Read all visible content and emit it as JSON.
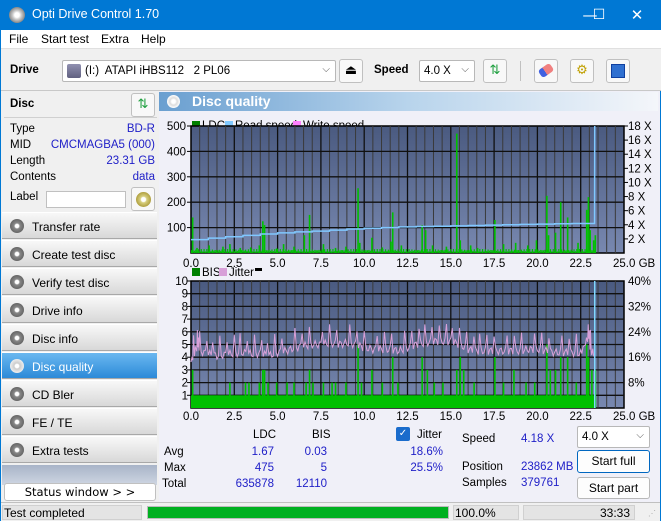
{
  "window": {
    "title": "Opti Drive Control 1.70",
    "minimize": "—",
    "maximize": "☐",
    "close": "✕"
  },
  "menu": [
    "File",
    "Start test",
    "Extra",
    "Help"
  ],
  "toolbar": {
    "drive_label": "Drive",
    "drive_value": "(I:)  ATAPI iHBS112   2 PL06",
    "speed_label": "Speed",
    "speed_value": "4.0 X",
    "icons": [
      "eject-icon",
      "refresh-icon",
      "erase-icon",
      "settings-icon",
      "save-icon"
    ]
  },
  "disc": {
    "header": "Disc",
    "rows": [
      {
        "key": "Type",
        "value": "BD-R"
      },
      {
        "key": "MID",
        "value": "CMCMAGBA5 (000)"
      },
      {
        "key": "Length",
        "value": "23.31 GB"
      },
      {
        "key": "Contents",
        "value": "data"
      }
    ],
    "label_key": "Label",
    "label_value": ""
  },
  "nav": [
    {
      "label": "Transfer rate",
      "active": false
    },
    {
      "label": "Create test disc",
      "active": false
    },
    {
      "label": "Verify test disc",
      "active": false
    },
    {
      "label": "Drive info",
      "active": false
    },
    {
      "label": "Disc info",
      "active": false
    },
    {
      "label": "Disc quality",
      "active": true
    },
    {
      "label": "CD Bler",
      "active": false
    },
    {
      "label": "FE / TE",
      "active": false
    },
    {
      "label": "Extra tests",
      "active": false
    }
  ],
  "status_window_button": "Status window > >",
  "panel_title": "Disc quality",
  "colors": {
    "ldc": "#00c000",
    "read_speed": "#80c8ff",
    "write_speed": "#ff80ff",
    "bis": "#00c000",
    "jitter": "#d8a0d8",
    "plot_bg_top": "#4a5a80",
    "plot_bg_bottom": "#7888b0",
    "progress": "#00b020"
  },
  "chart_data": [
    {
      "type": "bar",
      "title": "LDC / Read speed",
      "legend": [
        "LDC",
        "Read speed",
        "Write speed"
      ],
      "legend_position": "top-left",
      "xlabel": "GB",
      "x_ticks": [
        "0.0",
        "2.5",
        "5.0",
        "7.5",
        "10.0",
        "12.5",
        "15.0",
        "17.5",
        "20.0",
        "22.5",
        "25.0 GB"
      ],
      "xlim": [
        0,
        25
      ],
      "y_ticks": [
        "100",
        "200",
        "300",
        "400",
        "500"
      ],
      "ylim": [
        0,
        500
      ],
      "y2_ticks": [
        "2 X",
        "4 X",
        "6 X",
        "8 X",
        "10 X",
        "12 X",
        "14 X",
        "16 X",
        "18 X"
      ],
      "y2lim": [
        0,
        18
      ],
      "grid": true,
      "ldc_spikes": [
        {
          "x": 0.05,
          "y": 140
        },
        {
          "x": 0.3,
          "y": 20
        },
        {
          "x": 1.0,
          "y": 30
        },
        {
          "x": 1.8,
          "y": 25
        },
        {
          "x": 2.2,
          "y": 35
        },
        {
          "x": 2.8,
          "y": 20
        },
        {
          "x": 3.4,
          "y": 22
        },
        {
          "x": 3.9,
          "y": 30
        },
        {
          "x": 4.1,
          "y": 125
        },
        {
          "x": 4.2,
          "y": 110
        },
        {
          "x": 4.9,
          "y": 18
        },
        {
          "x": 5.3,
          "y": 35
        },
        {
          "x": 5.9,
          "y": 25
        },
        {
          "x": 6.5,
          "y": 70
        },
        {
          "x": 6.8,
          "y": 150
        },
        {
          "x": 7.6,
          "y": 35
        },
        {
          "x": 8.3,
          "y": 20
        },
        {
          "x": 8.9,
          "y": 25
        },
        {
          "x": 9.6,
          "y": 255
        },
        {
          "x": 9.7,
          "y": 40
        },
        {
          "x": 10.4,
          "y": 60
        },
        {
          "x": 11.0,
          "y": 22
        },
        {
          "x": 11.5,
          "y": 45
        },
        {
          "x": 11.6,
          "y": 160
        },
        {
          "x": 12.1,
          "y": 30
        },
        {
          "x": 13.3,
          "y": 110
        },
        {
          "x": 13.5,
          "y": 90
        },
        {
          "x": 13.9,
          "y": 30
        },
        {
          "x": 14.7,
          "y": 25
        },
        {
          "x": 15.3,
          "y": 470
        },
        {
          "x": 15.5,
          "y": 50
        },
        {
          "x": 16.1,
          "y": 30
        },
        {
          "x": 16.5,
          "y": 20
        },
        {
          "x": 17.5,
          "y": 130
        },
        {
          "x": 18.0,
          "y": 35
        },
        {
          "x": 18.7,
          "y": 40
        },
        {
          "x": 19.4,
          "y": 30
        },
        {
          "x": 19.9,
          "y": 50
        },
        {
          "x": 20.5,
          "y": 225
        },
        {
          "x": 20.6,
          "y": 70
        },
        {
          "x": 21.0,
          "y": 80
        },
        {
          "x": 21.3,
          "y": 200
        },
        {
          "x": 21.7,
          "y": 140
        },
        {
          "x": 22.3,
          "y": 40
        },
        {
          "x": 22.8,
          "y": 170
        },
        {
          "x": 22.9,
          "y": 220
        },
        {
          "x": 23.0,
          "y": 90
        },
        {
          "x": 23.2,
          "y": 50
        },
        {
          "x": 23.3,
          "y": 70
        }
      ],
      "read_speed": [
        {
          "x": 0.0,
          "y": 1.9
        },
        {
          "x": 1.0,
          "y": 2.1
        },
        {
          "x": 2.0,
          "y": 2.3
        },
        {
          "x": 3.0,
          "y": 2.5
        },
        {
          "x": 4.0,
          "y": 2.7
        },
        {
          "x": 5.0,
          "y": 2.85
        },
        {
          "x": 6.0,
          "y": 3.0
        },
        {
          "x": 7.0,
          "y": 3.1
        },
        {
          "x": 8.0,
          "y": 3.25
        },
        {
          "x": 9.0,
          "y": 3.4
        },
        {
          "x": 10.0,
          "y": 3.5
        },
        {
          "x": 11.0,
          "y": 3.6
        },
        {
          "x": 12.0,
          "y": 3.7
        },
        {
          "x": 13.0,
          "y": 3.75
        },
        {
          "x": 14.0,
          "y": 3.8
        },
        {
          "x": 15.0,
          "y": 3.85
        },
        {
          "x": 16.0,
          "y": 3.9
        },
        {
          "x": 17.0,
          "y": 3.95
        },
        {
          "x": 18.0,
          "y": 4.0
        },
        {
          "x": 19.0,
          "y": 4.05
        },
        {
          "x": 20.0,
          "y": 4.1
        },
        {
          "x": 21.0,
          "y": 4.15
        },
        {
          "x": 22.0,
          "y": 4.18
        },
        {
          "x": 23.3,
          "y": 4.2
        },
        {
          "x": 23.31,
          "y": 18
        }
      ]
    },
    {
      "type": "bar",
      "title": "BIS / Jitter",
      "legend": [
        "BIS",
        "Jitter"
      ],
      "legend_position": "top-left",
      "xlabel": "GB",
      "x_ticks": [
        "0.0",
        "2.5",
        "5.0",
        "7.5",
        "10.0",
        "12.5",
        "15.0",
        "17.5",
        "20.0",
        "22.5",
        "25.0 GB"
      ],
      "xlim": [
        0,
        25
      ],
      "y_ticks": [
        "1",
        "2",
        "3",
        "4",
        "5",
        "6",
        "7",
        "8",
        "9",
        "10"
      ],
      "ylim": [
        0,
        10
      ],
      "y2_ticks": [
        "8%",
        "16%",
        "24%",
        "32%",
        "40%"
      ],
      "y2lim": [
        0,
        40
      ],
      "grid": true,
      "bis_baseline": 1,
      "bis_spikes": [
        {
          "x": 0.05,
          "y": 3
        },
        {
          "x": 2.2,
          "y": 2
        },
        {
          "x": 3.1,
          "y": 2
        },
        {
          "x": 3.3,
          "y": 2
        },
        {
          "x": 3.9,
          "y": 2
        },
        {
          "x": 4.1,
          "y": 3
        },
        {
          "x": 4.2,
          "y": 3
        },
        {
          "x": 4.4,
          "y": 2
        },
        {
          "x": 4.9,
          "y": 2
        },
        {
          "x": 5.5,
          "y": 2
        },
        {
          "x": 5.9,
          "y": 2
        },
        {
          "x": 6.6,
          "y": 2
        },
        {
          "x": 6.8,
          "y": 3
        },
        {
          "x": 7.0,
          "y": 2
        },
        {
          "x": 7.6,
          "y": 2
        },
        {
          "x": 8.1,
          "y": 2
        },
        {
          "x": 8.3,
          "y": 2
        },
        {
          "x": 8.9,
          "y": 2
        },
        {
          "x": 9.6,
          "y": 5
        },
        {
          "x": 9.8,
          "y": 2
        },
        {
          "x": 10.4,
          "y": 3
        },
        {
          "x": 11.0,
          "y": 2
        },
        {
          "x": 11.6,
          "y": 4
        },
        {
          "x": 11.9,
          "y": 2
        },
        {
          "x": 13.3,
          "y": 4
        },
        {
          "x": 13.6,
          "y": 3
        },
        {
          "x": 14.0,
          "y": 2
        },
        {
          "x": 14.5,
          "y": 2
        },
        {
          "x": 15.3,
          "y": 3
        },
        {
          "x": 15.5,
          "y": 4
        },
        {
          "x": 15.7,
          "y": 3
        },
        {
          "x": 16.3,
          "y": 2
        },
        {
          "x": 17.5,
          "y": 4
        },
        {
          "x": 18.0,
          "y": 2
        },
        {
          "x": 18.6,
          "y": 3
        },
        {
          "x": 19.3,
          "y": 2
        },
        {
          "x": 19.8,
          "y": 2
        },
        {
          "x": 20.5,
          "y": 5
        },
        {
          "x": 20.7,
          "y": 3
        },
        {
          "x": 21.0,
          "y": 3
        },
        {
          "x": 21.3,
          "y": 4
        },
        {
          "x": 21.7,
          "y": 4
        },
        {
          "x": 22.2,
          "y": 2
        },
        {
          "x": 22.8,
          "y": 5
        },
        {
          "x": 22.9,
          "y": 4
        },
        {
          "x": 23.1,
          "y": 3
        },
        {
          "x": 23.3,
          "y": 3
        }
      ],
      "jitter": [
        {
          "x": 0.0,
          "y": 14.5
        },
        {
          "x": 0.3,
          "y": 19
        },
        {
          "x": 0.5,
          "y": 18
        },
        {
          "x": 1.0,
          "y": 17
        },
        {
          "x": 1.5,
          "y": 16.5
        },
        {
          "x": 2.0,
          "y": 16.8
        },
        {
          "x": 2.5,
          "y": 17.2
        },
        {
          "x": 3.0,
          "y": 17.5
        },
        {
          "x": 3.5,
          "y": 17
        },
        {
          "x": 4.0,
          "y": 17.2
        },
        {
          "x": 4.5,
          "y": 16.5
        },
        {
          "x": 5.0,
          "y": 17.5
        },
        {
          "x": 5.5,
          "y": 18
        },
        {
          "x": 6.0,
          "y": 19
        },
        {
          "x": 6.5,
          "y": 19.5
        },
        {
          "x": 7.0,
          "y": 20
        },
        {
          "x": 7.5,
          "y": 20
        },
        {
          "x": 8.0,
          "y": 20.5
        },
        {
          "x": 8.5,
          "y": 20
        },
        {
          "x": 9.0,
          "y": 20.5
        },
        {
          "x": 9.5,
          "y": 20
        },
        {
          "x": 10.0,
          "y": 19
        },
        {
          "x": 10.5,
          "y": 18.5
        },
        {
          "x": 11.0,
          "y": 18.5
        },
        {
          "x": 11.5,
          "y": 18.5
        },
        {
          "x": 12.0,
          "y": 18
        },
        {
          "x": 12.5,
          "y": 19
        },
        {
          "x": 13.0,
          "y": 20
        },
        {
          "x": 13.5,
          "y": 20.5
        },
        {
          "x": 14.0,
          "y": 21
        },
        {
          "x": 14.5,
          "y": 21
        },
        {
          "x": 15.0,
          "y": 21
        },
        {
          "x": 15.5,
          "y": 20
        },
        {
          "x": 16.0,
          "y": 18.5
        },
        {
          "x": 16.5,
          "y": 18
        },
        {
          "x": 17.0,
          "y": 18
        },
        {
          "x": 17.5,
          "y": 18
        },
        {
          "x": 18.0,
          "y": 18
        },
        {
          "x": 18.5,
          "y": 18
        },
        {
          "x": 19.0,
          "y": 18
        },
        {
          "x": 19.5,
          "y": 18.5
        },
        {
          "x": 20.0,
          "y": 18.5
        },
        {
          "x": 20.5,
          "y": 18
        },
        {
          "x": 21.0,
          "y": 17.5
        },
        {
          "x": 21.5,
          "y": 17.5
        },
        {
          "x": 22.0,
          "y": 17.5
        },
        {
          "x": 22.5,
          "y": 17.2
        },
        {
          "x": 22.9,
          "y": 22
        },
        {
          "x": 23.1,
          "y": 18
        },
        {
          "x": 23.3,
          "y": 17
        }
      ],
      "position_marker_x": 23.31
    }
  ],
  "stats": {
    "col_ldc": "LDC",
    "col_bis": "BIS",
    "jitter_label": "Jitter",
    "jitter_checked": true,
    "rows": [
      {
        "label": "Avg",
        "ldc": "1.67",
        "bis": "0.03",
        "jitter": "18.6%"
      },
      {
        "label": "Max",
        "ldc": "475",
        "bis": "5",
        "jitter": "25.5%"
      },
      {
        "label": "Total",
        "ldc": "635878",
        "bis": "12110",
        "jitter": ""
      }
    ],
    "speed_label": "Speed",
    "speed_value": "4.18 X",
    "position_label": "Position",
    "position_value": "23862 MB",
    "samples_label": "Samples",
    "samples_value": "379761",
    "speed_select": "4.0 X",
    "start_full": "Start full",
    "start_part": "Start part"
  },
  "statusbar": {
    "text": "Test completed",
    "progress": 1.0,
    "percent": "100.0%",
    "elapsed": "33:33"
  }
}
